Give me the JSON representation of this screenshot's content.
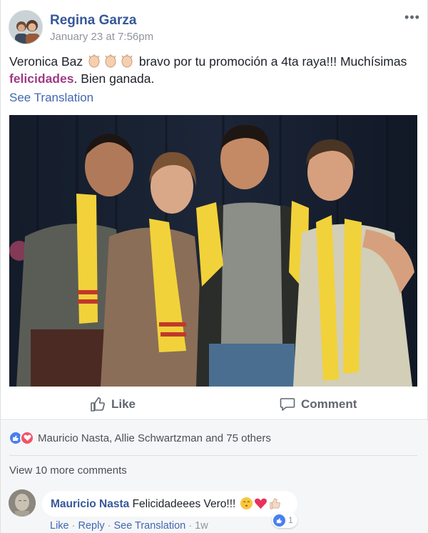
{
  "post": {
    "author": "Regina Garza",
    "timestamp": "January 23 at 7:56pm",
    "more_icon": "ellipsis-icon",
    "text_prefix": "Veronica Baz",
    "text_middle": " bravo por tu promoción a 4ta raya!!! Muchísimas ",
    "hashtag": "felicidades",
    "text_suffix": ". Bien ganada.",
    "claps_icon": "clapping-hands-icon",
    "see_translation": "See Translation"
  },
  "actions": {
    "like_label": "Like",
    "comment_label": "Comment"
  },
  "reactions": {
    "summary": "Mauricio Nasta, Allie Schwartzman and 75 others",
    "icons": [
      "like-icon",
      "love-icon"
    ]
  },
  "comments": {
    "view_more": "View 10 more comments",
    "items": [
      {
        "author": "Mauricio Nasta",
        "text": "Felicidadeees Vero!!!",
        "emojis": [
          "kissing-face-icon",
          "heart-icon",
          "thumbs-up-icon"
        ],
        "reaction_count": "1",
        "like_link": "Like",
        "reply_link": "Reply",
        "translate_link": "See Translation",
        "age": "1w"
      }
    ]
  },
  "colors": {
    "link": "#365899",
    "hashtag": "#a03a86",
    "muted": "#90949c",
    "like_blue": "#4a7ff0",
    "love_red": "#f25268",
    "scarf_yellow": "#f2d23a"
  }
}
